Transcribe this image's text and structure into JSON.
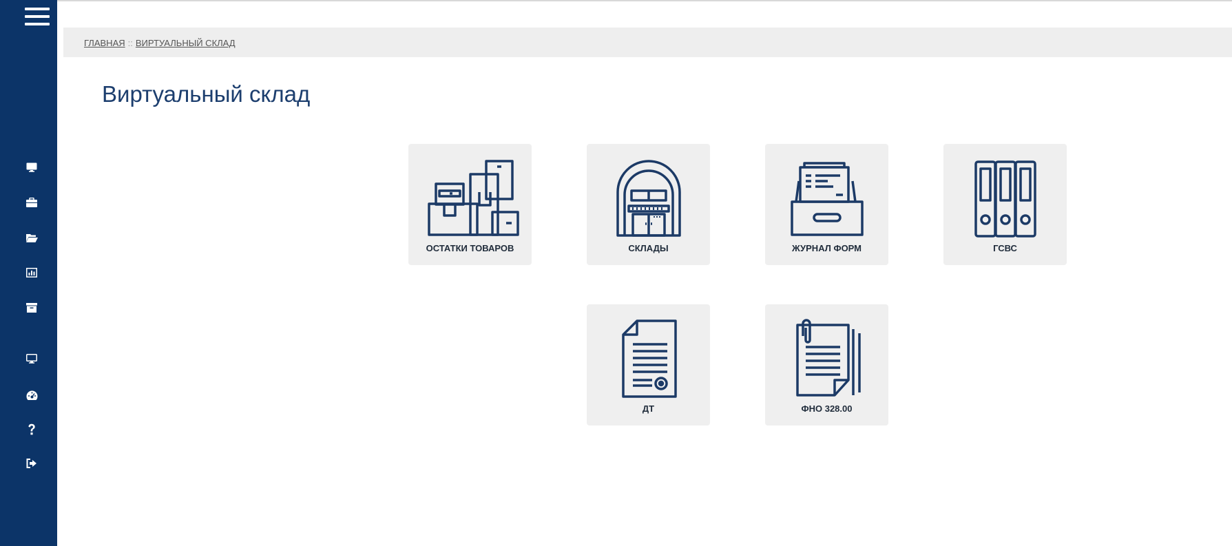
{
  "breadcrumb": {
    "home": "ГЛАВНАЯ",
    "separator": "::",
    "current": "ВИРТУАЛЬНЫЙ СКЛАД"
  },
  "page": {
    "title": "Виртуальный склад"
  },
  "tiles": [
    {
      "label": "ОСТАТКИ ТОВАРОВ",
      "icon": "boxes-icon"
    },
    {
      "label": "СКЛАДЫ",
      "icon": "warehouse-icon"
    },
    {
      "label": "ЖУРНАЛ ФОРМ",
      "icon": "card-file-icon"
    },
    {
      "label": "ГСВС",
      "icon": "binders-icon"
    },
    {
      "label": "ДТ",
      "icon": "document-seal-icon"
    },
    {
      "label": "ФНО 328.00",
      "icon": "clipped-documents-icon"
    }
  ],
  "sidebar": {
    "icons": [
      "menu-icon",
      "monitor-icon",
      "briefcase-icon",
      "folder-open-icon",
      "bar-chart-icon",
      "archive-icon",
      "monitor-icon",
      "dashboard-icon",
      "help-icon",
      "sign-out-icon"
    ]
  },
  "colors": {
    "sidebar": "#0c3468",
    "icon_stroke": "#1c3a66",
    "tile_bg": "#efefef",
    "title": "#1c3e6e"
  }
}
